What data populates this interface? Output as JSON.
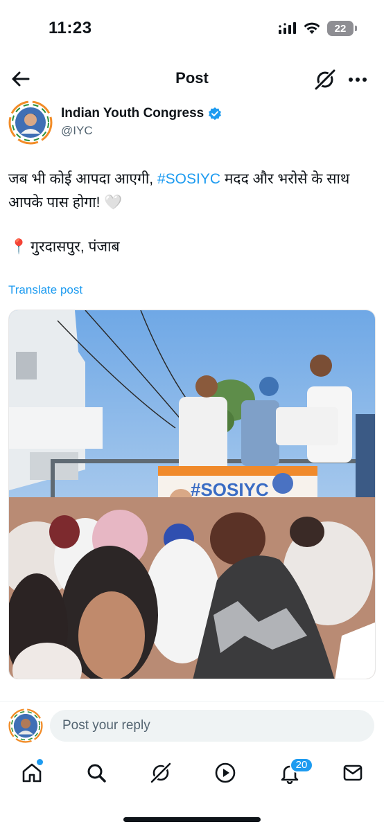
{
  "status_bar": {
    "time": "11:23",
    "battery": "22"
  },
  "header": {
    "title": "Post"
  },
  "author": {
    "name": "Indian Youth Congress",
    "handle": "@IYC",
    "verified": true
  },
  "post": {
    "text_before": "जब भी कोई आपदा आएगी, ",
    "hashtag": "#SOSIYC",
    "text_after": " मदद और भरोसे के साथ आपके पास होगा! ",
    "heart": "🤍",
    "location_pin": "📍",
    "location": "गुरदासपुर, पंजाब"
  },
  "translate_label": "Translate post",
  "media": {
    "banner_text": "#SOSIYC"
  },
  "reply": {
    "placeholder": "Post your reply"
  },
  "tab_bar": {
    "notifications_count": "20"
  },
  "colors": {
    "accent": "#1d9bf0",
    "text": "#0f1419",
    "secondary": "#536471",
    "input_bg": "#eff3f4"
  },
  "icons": [
    "back-arrow-icon",
    "grok-icon",
    "more-icon",
    "verified-icon",
    "mute-icon",
    "home-icon",
    "search-icon",
    "grok-tab-icon",
    "video-icon",
    "bell-icon",
    "mail-icon"
  ]
}
